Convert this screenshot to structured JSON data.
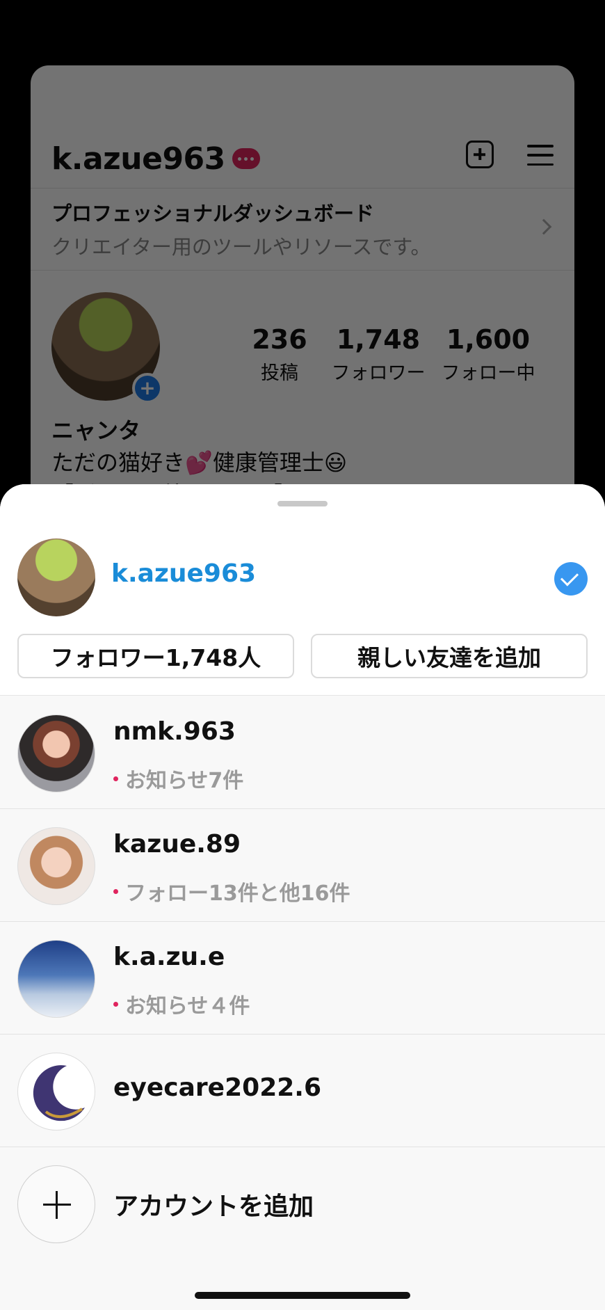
{
  "profile": {
    "username": "k.azue963",
    "dashboard_title": "プロフェッショナルダッシュボード",
    "dashboard_subtitle": "クリエイター用のツールやリソースです。",
    "stats": [
      {
        "value": "236",
        "label": "投稿"
      },
      {
        "value": "1,748",
        "label": "フォロワー"
      },
      {
        "value": "1,600",
        "label": "フォロー中"
      }
    ],
    "display_name": "ニャンタ",
    "bio_line1": "ただの猫好き💕健康管理士😃",
    "bio_line2": "【ずっと一緒にいたい】だから"
  },
  "sheet": {
    "current_account": "k.azue963",
    "followers_button": "フォロワー1,748人",
    "close_friends_button": "親しい友達を追加",
    "accounts": [
      {
        "name": "nmk.963",
        "notice": "お知らせ7件"
      },
      {
        "name": "kazue.89",
        "notice": "フォロー13件と他16件"
      },
      {
        "name": "k.a.zu.e",
        "notice": "お知らせ４件"
      },
      {
        "name": "eyecare2022.6",
        "notice": ""
      }
    ],
    "add_account": "アカウントを追加"
  },
  "colors": {
    "accent_blue": "#1a8cd8",
    "check_blue": "#3897f0",
    "notice_dot": "#e0245e"
  }
}
